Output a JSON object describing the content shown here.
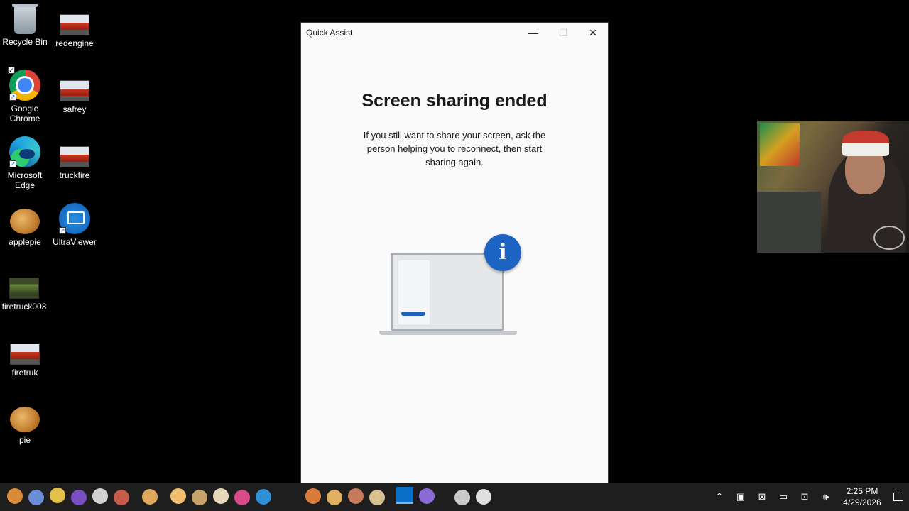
{
  "desktop": {
    "icons": [
      {
        "label": "Recycle Bin",
        "icon": "recycle-bin-icon"
      },
      {
        "label": "redengine",
        "icon": "photo-icon"
      },
      {
        "label": "Google Chrome",
        "icon": "chrome-icon"
      },
      {
        "label": "safrey",
        "icon": "photo-icon"
      },
      {
        "label": "Microsoft Edge",
        "icon": "edge-icon"
      },
      {
        "label": "truckfire",
        "icon": "photo-icon"
      },
      {
        "label": "applepie",
        "icon": "photo-icon"
      },
      {
        "label": "UltraViewer",
        "icon": "ultraviewer-icon"
      },
      {
        "label": "firetruck003",
        "icon": "photo-icon"
      },
      {
        "label": "firetruk",
        "icon": "photo-icon"
      },
      {
        "label": "pie",
        "icon": "photo-icon"
      }
    ]
  },
  "window": {
    "title": "Quick Assist",
    "minimize_glyph": "—",
    "maximize_glyph": "☐",
    "close_glyph": "✕",
    "heading": "Screen sharing ended",
    "message": "If you still want to share your screen, ask the person helping you to reconnect, then start sharing again.",
    "info_glyph": "i",
    "accent_color": "#1c63c3"
  },
  "taskbar": {
    "time": "2:25 PM",
    "date": "4/29/2026",
    "tray_icons": [
      "chevron-up-icon",
      "meet-now-icon",
      "task-manager-icon",
      "battery-icon",
      "network-icon",
      "volume-icon"
    ]
  }
}
